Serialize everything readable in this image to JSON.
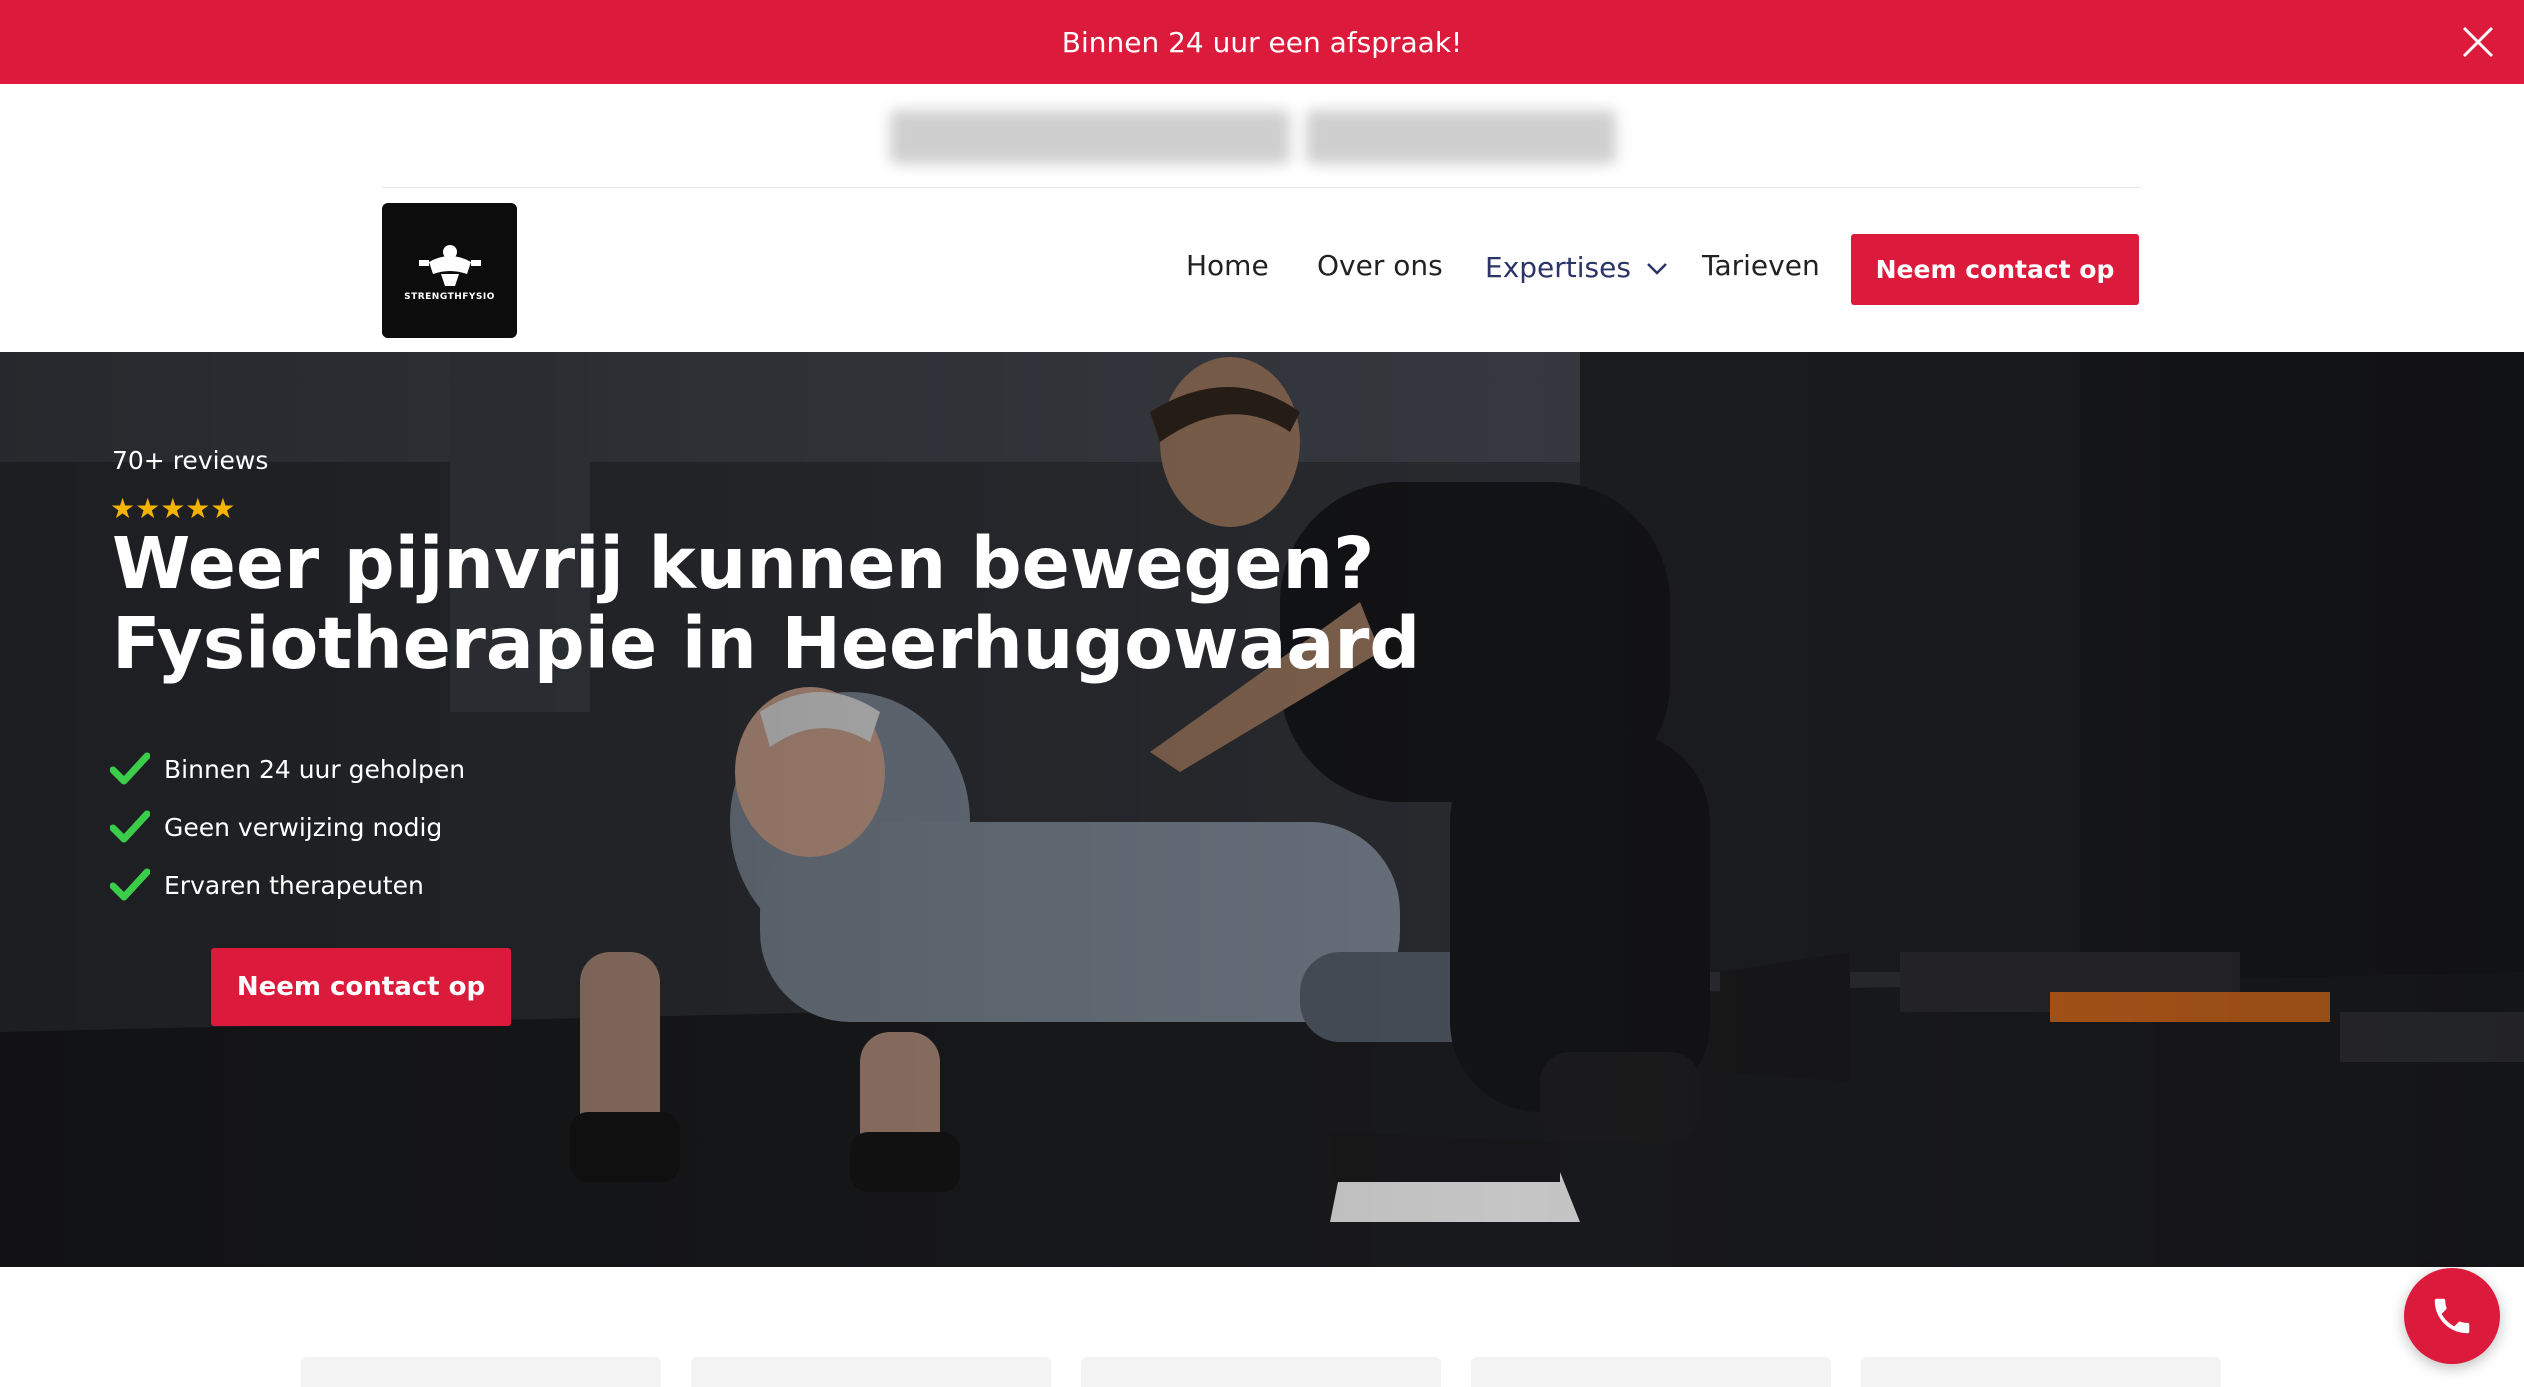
{
  "announcement": {
    "text": "Binnen 24 uur een afspraak!",
    "close_icon": "close-icon"
  },
  "brand": {
    "logo_text": "STRENGTHFYSIO",
    "accent_color": "#dc1a3c"
  },
  "nav": {
    "items": [
      {
        "label": "Home"
      },
      {
        "label": "Over ons"
      },
      {
        "label": "Expertises",
        "icon": "chevron-down-icon"
      },
      {
        "label": "Tarieven"
      }
    ],
    "cta_label": "Neem contact op"
  },
  "hero": {
    "reviews": "70+ reviews",
    "stars": "★★★★★",
    "rating": 5,
    "title_line1": "Weer pijnvrij kunnen bewegen?",
    "title_line2": "Fysiotherapie in Heerhugowaard",
    "checklist": [
      "Binnen 24 uur geholpen",
      "Geen verwijzing nodig",
      "Ervaren therapeuten"
    ],
    "cta_label": "Neem contact op"
  },
  "floating": {
    "phone_icon": "phone-icon"
  }
}
